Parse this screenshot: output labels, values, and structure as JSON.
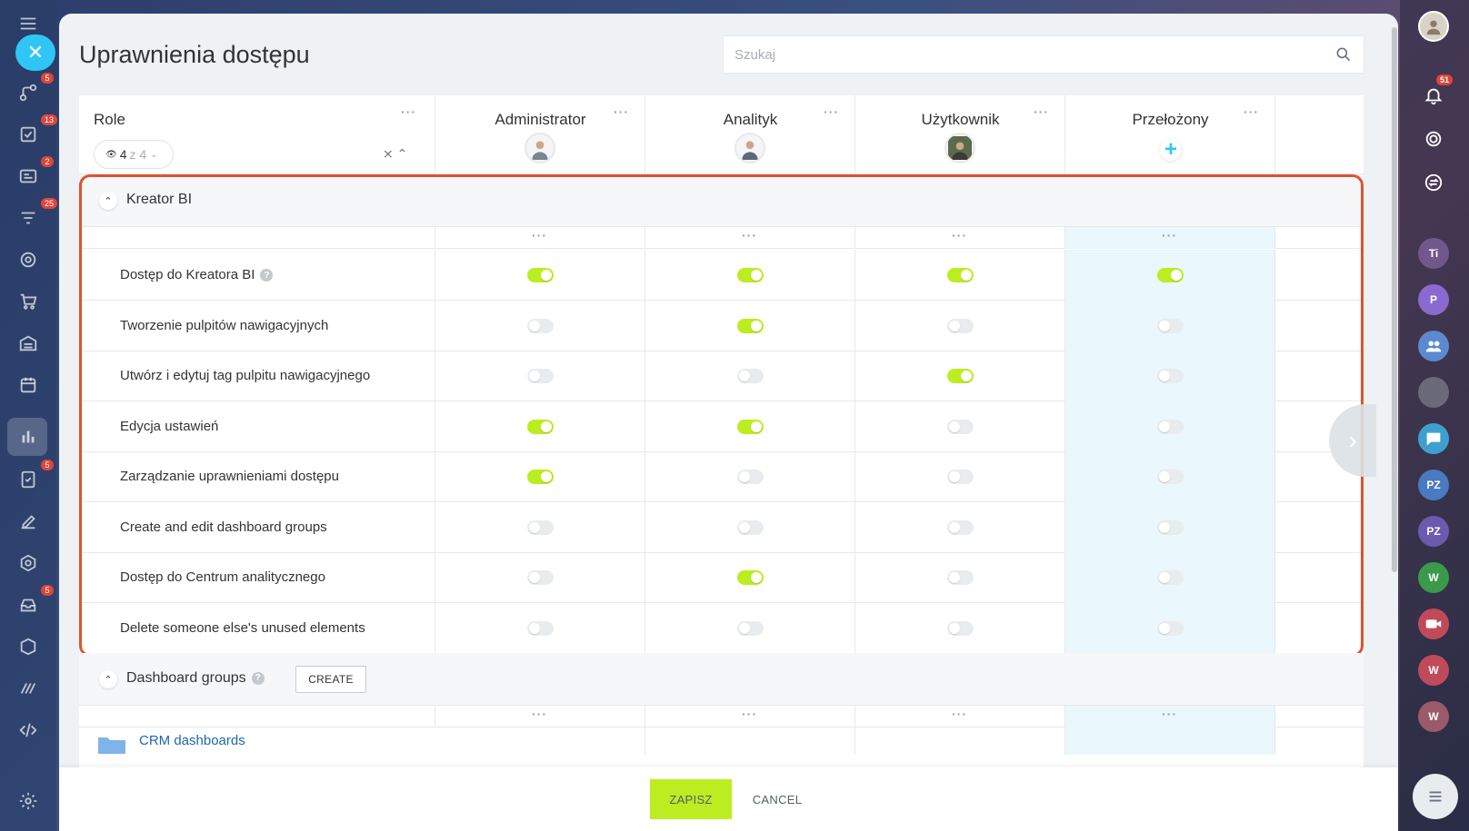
{
  "page": {
    "title": "Uprawnienia dostępu",
    "search_placeholder": "Szukaj"
  },
  "left_sidebar": {
    "badges": [
      "5",
      "13",
      "2",
      "25",
      "5",
      "5"
    ]
  },
  "right_sidebar": {
    "notifications_badge": "51",
    "avatars": [
      "Ti",
      "P",
      "PZ",
      "PZ",
      "W",
      "W",
      "W"
    ]
  },
  "header": {
    "role_label": "Role",
    "filter_count": "4",
    "filter_total": "z 4",
    "columns": [
      {
        "name": "Administrator",
        "has_avatar": true
      },
      {
        "name": "Analityk",
        "has_avatar": true
      },
      {
        "name": "Użytkownik",
        "has_avatar": true
      },
      {
        "name": "Przełożony",
        "has_avatar": false
      }
    ]
  },
  "section_bi": {
    "name": "Kreator BI",
    "rows": [
      {
        "label": "Dostęp do Kreatora BI",
        "help": true,
        "values": [
          true,
          true,
          true,
          true
        ]
      },
      {
        "label": "Tworzenie pulpitów nawigacyjnych",
        "help": false,
        "values": [
          false,
          true,
          false,
          false
        ]
      },
      {
        "label": "Utwórz i edytuj tag pulpitu nawigacyjnego",
        "help": false,
        "values": [
          false,
          false,
          true,
          false
        ]
      },
      {
        "label": "Edycja ustawień",
        "help": false,
        "values": [
          true,
          true,
          false,
          false
        ]
      },
      {
        "label": "Zarządzanie uprawnieniami dostępu",
        "help": false,
        "values": [
          true,
          false,
          false,
          false
        ]
      },
      {
        "label": "Create and edit dashboard groups",
        "help": false,
        "values": [
          false,
          false,
          false,
          false
        ]
      },
      {
        "label": "Dostęp do Centrum analitycznego",
        "help": false,
        "values": [
          false,
          true,
          false,
          false
        ]
      },
      {
        "label": "Delete someone else's unused elements",
        "help": false,
        "values": [
          false,
          false,
          false,
          false
        ]
      }
    ]
  },
  "section_groups": {
    "name": "Dashboard groups",
    "create_label": "CREATE",
    "first_item": "CRM dashboards"
  },
  "footer": {
    "save_label": "ZAPISZ",
    "cancel_label": "CANCEL"
  },
  "colors": {
    "toggle_on": "#bbed21",
    "toggle_off": "#e9ecee",
    "highlight_col": "#eaf7fd",
    "frame": "#e0532f",
    "accent": "#2fc6f6"
  }
}
